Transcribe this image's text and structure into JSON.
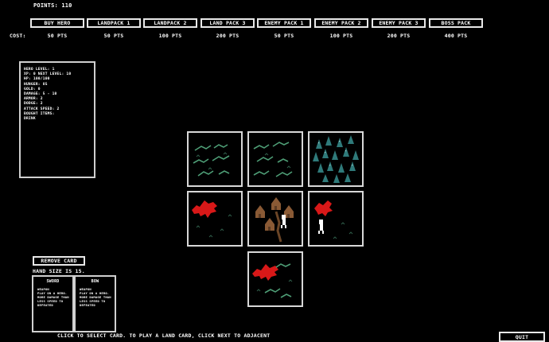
{
  "header": {
    "points": "POINTS: 110"
  },
  "shop": {
    "buttons": [
      "BUY HERO",
      "LANDPACK 1",
      "LANDPACK 2",
      "LAND PACK 3",
      "ENEMY PACK 1",
      "ENEMY PACK 2",
      "ENEMY PACK 3",
      "BOSS PACK"
    ],
    "cost_label": "COST:",
    "prices": [
      "50 PTS",
      "50 PTS",
      "100 PTS",
      "200 PTS",
      "50 PTS",
      "100 PTS",
      "200 PTS",
      "400 PTS"
    ]
  },
  "stats": {
    "lines": [
      "HERO LEVEL: 1",
      "XP: 0 NEXT LEVEL: 10",
      "HP: 100/100",
      "HUNGER: 85",
      "GOLD: 0",
      "DAMAGE: 5 - 10",
      "ARMOR: 2",
      "DODGE: 2",
      "ATTACK SPEED: 2",
      "BOUGHT ITEMS:",
      "DRINK"
    ]
  },
  "board": {
    "tiles": [
      "grassland",
      "grassland",
      "forest",
      "blood-grassland",
      "village",
      "blood-grassland-hero",
      "blood-grassland"
    ]
  },
  "hand": {
    "remove_label": "REMOVE CARD",
    "size_text": "HAND SIZE IS 15.",
    "cards": [
      {
        "title": "SWORD",
        "desc": [
          "WEAPON",
          "PLAY ON A HERO.",
          "MORE DAMAGE THAN",
          "LESS SPEED TO",
          "DEFEATED"
        ]
      },
      {
        "title": "BOW",
        "desc": [
          "WEAPON",
          "PLAY ON A HERO.",
          "MORE DAMAGE THAN",
          "LESS SPEED TO",
          "DEFEATED"
        ]
      }
    ]
  },
  "footer": {
    "instructions": "CLICK TO SELECT CARD. TO PLAY A LAND CARD, CLICK NEXT TO ADJACENT",
    "quit_label": "QUIT"
  },
  "colors": {
    "grass": "#4e9e76",
    "forest": "#2f7a7a",
    "blood": "#d81818",
    "border": "#d8d8d8",
    "house": "#8a5a35"
  }
}
